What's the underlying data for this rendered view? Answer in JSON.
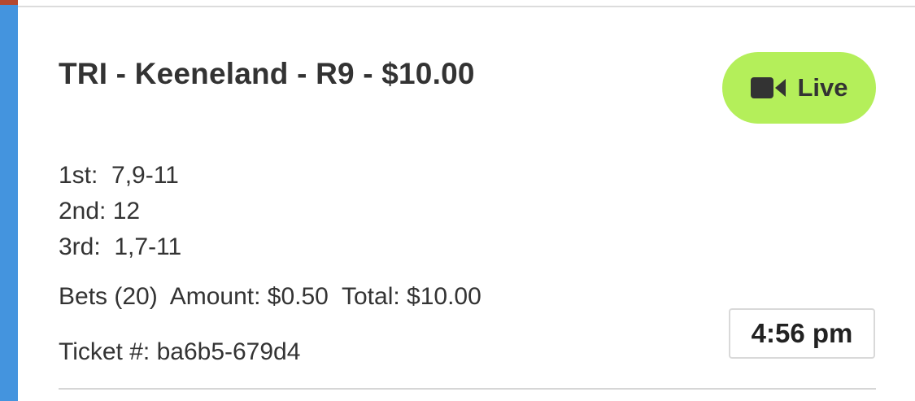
{
  "card": {
    "title": "TRI - Keeneland - R9 - $10.00",
    "live_button": {
      "label": "Live",
      "icon": "video-camera-icon",
      "color": "#b4ef5a"
    },
    "picks": [
      {
        "text": "1st:  7,9-11"
      },
      {
        "text": "2nd: 12"
      },
      {
        "text": "3rd:  1,7-11"
      }
    ],
    "bets_line": "Bets (20)  Amount: $0.50  Total: $10.00",
    "ticket_line": "Ticket #: ba6b5-679d4",
    "time": "4:56 pm"
  },
  "colors": {
    "accent": "#4494de",
    "corner": "#b5482f",
    "text": "#333333"
  }
}
